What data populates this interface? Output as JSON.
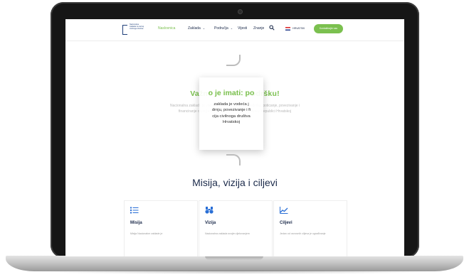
{
  "nav": {
    "logo_text": "Nacionalna zaklada za razvoj civilnoga društva",
    "items": [
      {
        "label": "Naslovnica",
        "active": true
      },
      {
        "label": "Zaklada",
        "dropdown": true
      },
      {
        "label": "Područja",
        "dropdown": true
      },
      {
        "label": "Vijesti"
      },
      {
        "label": "Znanje"
      }
    ],
    "search_icon": "search-icon",
    "language": "HRVATSKI",
    "cta_label": "Kontaktirajte nas"
  },
  "hero": {
    "title": "Važno je imati: podršku!",
    "description": "Nacionalna zaklada je vodeća javna institucija za podršku, poticanje, povezivanje i financiranje razvoja organizacija civilnoga društva u Republici Hrvatskoj",
    "overlay_title": "o je imati: po",
    "overlay_lines": [
      "zaklada je vodeća j",
      "drnju, povezivanje i fi",
      "cija civilnoga društva",
      "Hrvatskoj"
    ]
  },
  "section": {
    "title": "Misija, vizija i ciljevi",
    "cards": [
      {
        "icon": "list-icon",
        "title": "Misija",
        "text": "Misija Nacionalne zaklade je"
      },
      {
        "icon": "binoculars-icon",
        "title": "Vizija",
        "text": "Nacionalna zaklada svojim djelovanjem"
      },
      {
        "icon": "chart-icon",
        "title": "Ciljevi",
        "text": "Jedan od osnovnih ciljeva je ugrađivanje"
      }
    ]
  },
  "colors": {
    "accent": "#7bc04f",
    "navy": "#1b2a4a"
  }
}
